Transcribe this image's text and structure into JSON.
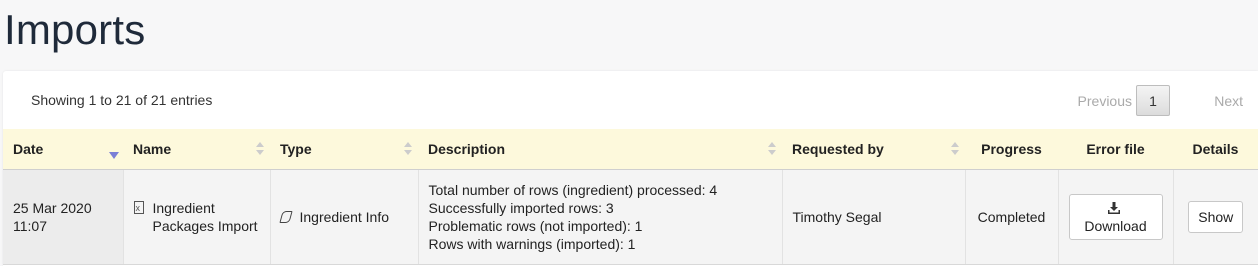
{
  "page": {
    "title": "Imports"
  },
  "table_info": "Showing 1 to 21 of 21 entries",
  "pagination": {
    "previous": "Previous",
    "current_page": "1",
    "next": "Next"
  },
  "columns": [
    {
      "label": "Date",
      "sort": "desc"
    },
    {
      "label": "Name",
      "sort": "both"
    },
    {
      "label": "Type",
      "sort": "both"
    },
    {
      "label": "Description",
      "sort": "both"
    },
    {
      "label": "Requested by",
      "sort": "both"
    },
    {
      "label": "Progress"
    },
    {
      "label": "Error file"
    },
    {
      "label": "Details"
    }
  ],
  "rows": [
    {
      "date_line1": "25 Mar 2020",
      "date_line2": "11:07",
      "name": "Ingredient Packages Import",
      "name_icon": "file-excel-icon",
      "type": "Ingredient Info",
      "type_icon": "tag-icon",
      "description": [
        "Total number of rows (ingredient) processed: 4",
        "Successfully imported rows: 3",
        "Problematic rows (not imported): 1",
        "Rows with warnings (imported): 1"
      ],
      "requested_by": "Timothy Segal",
      "progress": "Completed",
      "error_file_label": "Download",
      "error_file_icon": "download-icon",
      "details_label": "Show"
    }
  ],
  "colors": {
    "header_bg": "#fdf9dc",
    "sort_active": "#7b7fd6",
    "title": "#1f2a3a"
  }
}
